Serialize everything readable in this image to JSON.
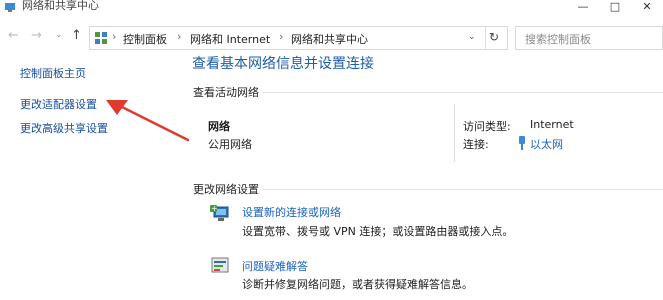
{
  "window": {
    "title": "网络和共享中心"
  },
  "nav": {
    "back_icon": "back-arrow",
    "forward_icon": "forward-arrow",
    "dropdown_icon": "chevron-down",
    "up_icon": "up-arrow"
  },
  "address": {
    "breadcrumbs": [
      "控制面板",
      "网络和 Internet",
      "网络和共享中心"
    ],
    "refresh_icon": "refresh"
  },
  "search": {
    "placeholder": "搜索控制面板"
  },
  "left_pane": {
    "items": [
      {
        "label": "控制面板主页"
      },
      {
        "label": "更改适配器设置"
      },
      {
        "label": "更改高级共享设置"
      }
    ]
  },
  "main": {
    "heading": "查看基本网络信息并设置连接",
    "active_networks_title": "查看活动网络",
    "network": {
      "name": "网络",
      "type": "公用网络",
      "access_type_label": "访问类型:",
      "access_type_value": "Internet",
      "connections_label": "连接:",
      "connection_name": "以太网"
    },
    "change_settings_title": "更改网络设置",
    "tasks": [
      {
        "title": "设置新的连接或网络",
        "desc": "设置宽带、拨号或 VPN 连接；或设置路由器或接入点。"
      },
      {
        "title": "问题疑难解答",
        "desc": "诊断并修复网络问题，或者获得疑难解答信息。"
      }
    ]
  },
  "colors": {
    "link": "#1a62c0",
    "heading": "#1e5da8",
    "annotation_arrow": "#e03a2f"
  }
}
